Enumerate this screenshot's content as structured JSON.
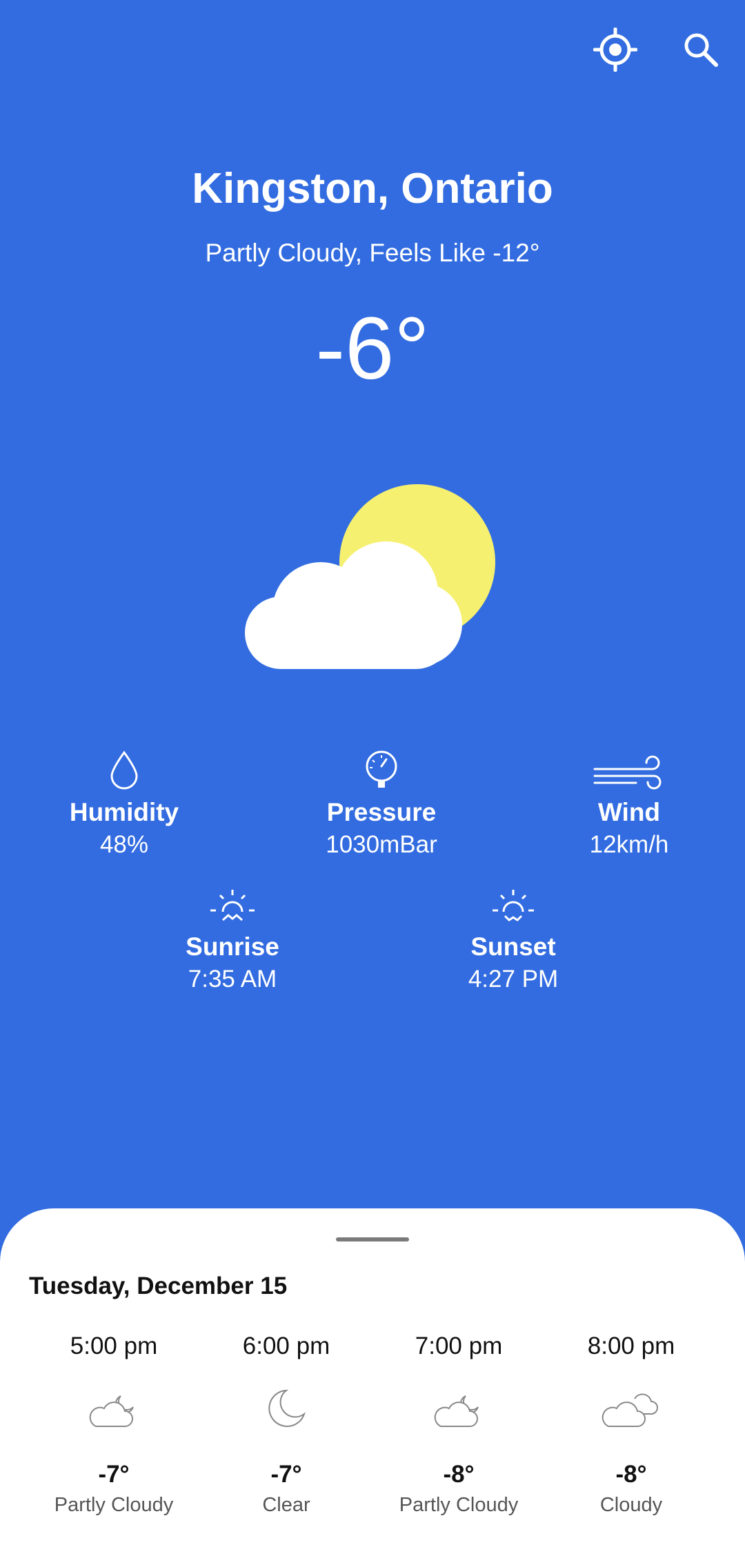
{
  "header": {
    "locate_icon": "crosshair-icon",
    "search_icon": "search-icon"
  },
  "current": {
    "city": "Kingston, Ontario",
    "summary": "Partly Cloudy, Feels Like -12°",
    "temperature": "-6°",
    "icon": "partly-cloudy-day-icon"
  },
  "stats": {
    "humidity": {
      "label": "Humidity",
      "value": "48%",
      "icon": "droplet-icon"
    },
    "pressure": {
      "label": "Pressure",
      "value": "1030mBar",
      "icon": "gauge-icon"
    },
    "wind": {
      "label": "Wind",
      "value": "12km/h",
      "icon": "wind-icon"
    },
    "sunrise": {
      "label": "Sunrise",
      "value": "7:35 AM",
      "icon": "sunrise-icon"
    },
    "sunset": {
      "label": "Sunset",
      "value": "4:27 PM",
      "icon": "sunset-icon"
    }
  },
  "forecast": {
    "date": "Tuesday, December 15",
    "hours": [
      {
        "time": "5:00 pm",
        "temp": "-7°",
        "condition": "Partly Cloudy",
        "icon": "partly-cloudy-night-icon"
      },
      {
        "time": "6:00 pm",
        "temp": "-7°",
        "condition": "Clear",
        "icon": "moon-icon"
      },
      {
        "time": "7:00 pm",
        "temp": "-8°",
        "condition": "Partly Cloudy",
        "icon": "partly-cloudy-night-icon"
      },
      {
        "time": "8:00 pm",
        "temp": "-8°",
        "condition": "Cloudy",
        "icon": "cloudy-icon"
      }
    ]
  },
  "colors": {
    "background": "#326CE0",
    "sun": "#F6F070",
    "sheet": "#FFFFFF",
    "text_on_blue": "#FFFFFF",
    "muted_text": "#555555"
  }
}
